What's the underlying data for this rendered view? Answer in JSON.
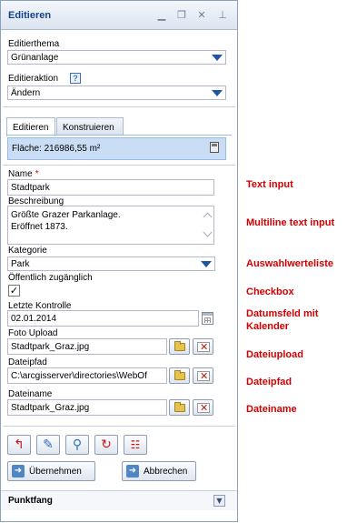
{
  "window": {
    "title": "Editieren"
  },
  "titlebar_icons": [
    "minimize-icon",
    "restore-icon",
    "close-icon",
    "pin-icon"
  ],
  "editierthema": {
    "label": "Editierthema",
    "value": "Grünanlage"
  },
  "editieraktion": {
    "label": "Editieraktion",
    "help": "?",
    "value": "Ändern"
  },
  "tabs": [
    {
      "label": "Editieren",
      "active": true
    },
    {
      "label": "Konstruieren",
      "active": false
    }
  ],
  "area": {
    "text": "Fläche: 216986,55 m²"
  },
  "fields": {
    "name": {
      "label": "Name",
      "required": "*",
      "value": "Stadtpark"
    },
    "beschreibung": {
      "label": "Beschreibung",
      "line1": "Größte Grazer Parkanlage.",
      "line2": "Eröffnet 1873."
    },
    "kategorie": {
      "label": "Kategorie",
      "value": "Park"
    },
    "oeffentlich": {
      "label": "Öffentlich zugänglich",
      "checked": "✓"
    },
    "letzte_kontrolle": {
      "label": "Letzte Kontrolle",
      "value": "02.01.2014"
    },
    "foto_upload": {
      "label": "Foto Upload",
      "value": "Stadtpark_Graz.jpg"
    },
    "dateipfad": {
      "label": "Dateipfad",
      "value": "C:\\arcgisserver\\directories\\WebOf"
    },
    "dateiname": {
      "label": "Dateiname",
      "value": "Stadtpark_Graz.jpg"
    }
  },
  "toolbar_icons": [
    "undo-icon",
    "vertex-edit-icon",
    "zoom-icon",
    "redo-icon",
    "attribute-table-icon"
  ],
  "buttons": {
    "apply": "Übernehmen",
    "cancel": "Abbrechen"
  },
  "footer": {
    "title": "Punktfang"
  },
  "annotations": {
    "text_input": "Text input",
    "multiline": "Multiline text input",
    "auswahl": "Auswahlwerteliste",
    "checkbox": "Checkbox",
    "datum": "Datumsfeld mit Kalender",
    "upload": "Dateiupload",
    "pfad": "Dateipfad",
    "name": "Dateiname"
  },
  "colors": {
    "accent": "#15428b",
    "annotation": "#d20000",
    "highlight": "#c9ddf5"
  }
}
